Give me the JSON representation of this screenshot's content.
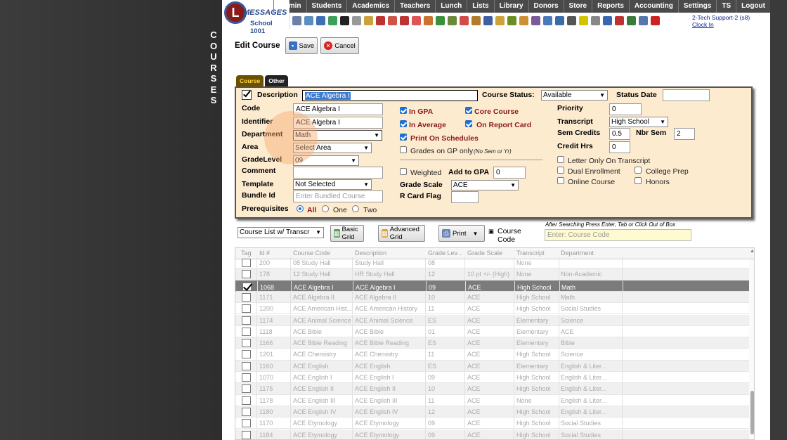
{
  "vertical_title": [
    "C",
    "O",
    "U",
    "R",
    "S",
    "E",
    "S"
  ],
  "logo": {
    "line1": "MESSAGES",
    "line2": "School 1001"
  },
  "menu": [
    "Admin",
    "Students",
    "Academics",
    "Teachers",
    "Lunch",
    "Lists",
    "Library",
    "Donors",
    "Store",
    "Reports",
    "Accounting",
    "Settings",
    "TS",
    "Logout"
  ],
  "user": {
    "name": "2-Tech Support-2 (s8)",
    "clock": "Clock In"
  },
  "edit": {
    "title": "Edit Course",
    "save": "Save",
    "cancel": "Cancel"
  },
  "tabs": [
    "Course",
    "Other"
  ],
  "form": {
    "description_label": "Description",
    "description": "ACE Algebra I",
    "status_label": "Course Status:",
    "status": "Available",
    "status_date_label": "Status Date",
    "status_date": "",
    "code_label": "Code",
    "code": "ACE Algebra I",
    "identifier_label": "Identifier",
    "identifier": "ACE Algebra I",
    "department_label": "Department",
    "department": "Math",
    "area_label": "Area",
    "area": "Select Area",
    "gradelevel_label": "GradeLevel",
    "gradelevel": "09",
    "comment_label": "Comment",
    "comment": "",
    "template_label": "Template",
    "template": "Not Selected",
    "bundle_label": "Bundle Id",
    "bundle_placeholder": "Enter Bundled Course",
    "prereq_label": "Prerequisites",
    "prereq_all": "All",
    "prereq_one": "One",
    "prereq_two": "Two",
    "in_gpa": "In GPA",
    "core_course": "Core Course",
    "in_average": "In Average",
    "on_report_card": "On Report Card",
    "print_on_schedules": "Print On Schedules",
    "grades_on_gp": "Grades on GP only",
    "grades_on_gp_note": "(No Sem or Yr)",
    "weighted": "Weighted",
    "add_to_gpa_label": "Add to GPA",
    "add_to_gpa": "0",
    "grade_scale_label": "Grade Scale",
    "grade_scale": "ACE",
    "rcard_label": "R Card Flag",
    "rcard": "",
    "priority_label": "Priority",
    "priority": "0",
    "transcript_label": "Transcript",
    "transcript": "High School",
    "sem_credits_label": "Sem Credits",
    "sem_credits": "0.5",
    "nbr_sem_label": "Nbr Sem",
    "nbr_sem": "2",
    "credit_hrs_label": "Credit Hrs",
    "credit_hrs": "0",
    "letter_only": "Letter Only On Transcript",
    "dual_enrollment": "Dual Enrollment",
    "college_prep": "College Prep",
    "online_course": "Online Course",
    "honors": "Honors"
  },
  "toolbar": {
    "list_select": "Course List w/ Transcr",
    "basic_grid": "Basic Grid",
    "advanced_grid": "Advanced Grid",
    "print": "Print",
    "course_code_label": "Course Code",
    "search_hint": "After Searching Press Enter, Tab or Click Out of Box",
    "search_placeholder": "Enter: Course Code"
  },
  "grid": {
    "headers": [
      "Tag",
      "Id #",
      "Course Code",
      "Description",
      "Grade Lev...",
      "Grade Scale",
      "Transcript",
      "Department"
    ],
    "rows": [
      [
        "200",
        "08 Study Hall",
        "Study Hall",
        "08",
        "",
        "None",
        ""
      ],
      [
        "178",
        "12 Study Hall",
        "HR Study Hall",
        "12",
        "10 pt +/- (High)",
        "None",
        "Non-Academic"
      ],
      [
        "1068",
        "ACE Algebra I",
        "ACE Algebra I",
        "09",
        "ACE",
        "High School",
        "Math"
      ],
      [
        "1171",
        "ACE Algebra II",
        "ACE Algebra II",
        "10",
        "ACE",
        "High School",
        "Math"
      ],
      [
        "1200",
        "ACE American Hist...",
        "ACE American History",
        "11",
        "ACE",
        "High School",
        "Social Studies"
      ],
      [
        "1174",
        "ACE Animal Science",
        "ACE Animal Science",
        "ES",
        "ACE",
        "Elementary",
        "Science"
      ],
      [
        "1118",
        "ACE Bible",
        "ACE Bible",
        "01",
        "ACE",
        "Elementary",
        "ACE"
      ],
      [
        "1166",
        "ACE Bible Reading",
        "ACE Bible Reading",
        "ES",
        "ACE",
        "Elementary",
        "Bible"
      ],
      [
        "1201",
        "ACE Chemistry",
        "ACE Chemistry",
        "11",
        "ACE",
        "High School",
        "Science"
      ],
      [
        "1160",
        "ACE English",
        "ACE English",
        "ES",
        "ACE",
        "Elementary",
        "English & Liter..."
      ],
      [
        "1070",
        "ACE English I",
        "ACE English I",
        "09",
        "ACE",
        "High School",
        "English & Liter..."
      ],
      [
        "1175",
        "ACE English II",
        "ACE English II",
        "10",
        "ACE",
        "High School",
        "English & Liter..."
      ],
      [
        "1178",
        "ACE English III",
        "ACE English III",
        "11",
        "ACE",
        "None",
        "English & Liter..."
      ],
      [
        "1180",
        "ACE English IV",
        "ACE English IV",
        "12",
        "ACE",
        "High School",
        "English & Liter..."
      ],
      [
        "1170",
        "ACE Etymology",
        "ACE Etymology",
        "09",
        "ACE",
        "High School",
        "Social Studies"
      ],
      [
        "1184",
        "ACE Etymology",
        "ACE Etymology",
        "09",
        "ACE",
        "High School",
        "Social Studies"
      ]
    ]
  }
}
